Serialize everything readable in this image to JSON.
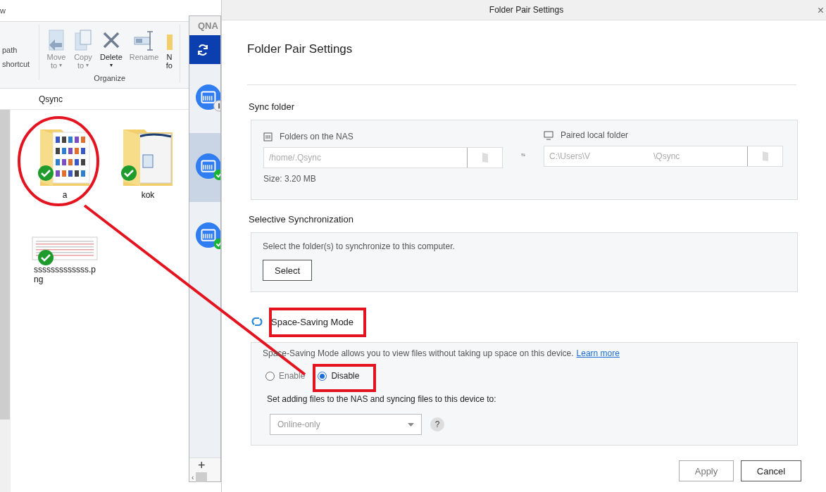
{
  "explorer": {
    "tab_fragment": "w",
    "ribbon_left": [
      "path",
      "shortcut"
    ],
    "ribbon_buttons": [
      {
        "kind": "move",
        "lines": [
          "Move",
          "to"
        ],
        "caret": "▾",
        "disabled": true
      },
      {
        "kind": "copy",
        "lines": [
          "Copy",
          "to"
        ],
        "caret": "▾",
        "disabled": true
      },
      {
        "kind": "delete",
        "lines": [
          "Delete"
        ],
        "caret": "▾",
        "disabled": false
      },
      {
        "kind": "rename",
        "lines": [
          "Rename"
        ],
        "disabled": true
      },
      {
        "kind": "newfolder",
        "lines": [
          "N",
          "fo"
        ],
        "disabled": false
      }
    ],
    "group_label": "Organize",
    "breadcrumb": "Qsync",
    "files": [
      {
        "kind": "pictures",
        "name": "a",
        "synced": true
      },
      {
        "kind": "document",
        "name": "kok",
        "synced": true
      },
      {
        "kind": "image",
        "name": "sssssssssssss.p\nng",
        "synced": true
      }
    ]
  },
  "qsync": {
    "logo": "QNA",
    "items": [
      {
        "kind": "paused",
        "selected": false
      },
      {
        "kind": "synced",
        "selected": true
      },
      {
        "kind": "synced",
        "selected": false
      }
    ],
    "add": "+",
    "scroll_left": "‹"
  },
  "dialog": {
    "window_title": "Folder Pair Settings",
    "close": "×",
    "heading": "Folder Pair Settings",
    "sync_folder": {
      "title": "Sync folder",
      "nas_label": "Folders on the NAS",
      "nas_value": "/home/.Qsync",
      "local_label": "Paired local folder",
      "local_value": "C:\\Users\\V",
      "local_value_tail": "\\Qsync",
      "size": "Size: 3.20 MB"
    },
    "selective": {
      "title": "Selective Synchronization",
      "text": "Select the folder(s) to synchronize to this computer.",
      "button": "Select"
    },
    "space_saving": {
      "title": "Space-Saving Mode",
      "text": "Space-Saving Mode allows you to view files without taking up space on this device.",
      "link": "Learn more",
      "options": [
        {
          "label": "Enable",
          "selected": false
        },
        {
          "label": "Disable",
          "selected": true
        }
      ],
      "setting_label": "Set adding files to the NAS and syncing files to this device to:",
      "dropdown": {
        "value": "Online-only",
        "disabled": true
      },
      "help": "?"
    },
    "buttons": [
      {
        "label": "Apply",
        "disabled": true
      },
      {
        "label": "Cancel",
        "disabled": false
      }
    ]
  }
}
